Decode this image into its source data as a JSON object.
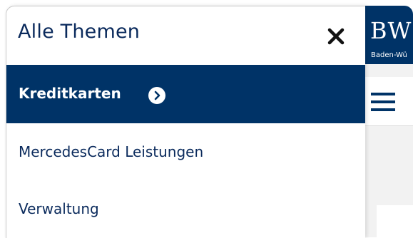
{
  "drawer": {
    "title": "Alle Themen",
    "close_icon": "close-icon",
    "items": [
      {
        "label": "Kreditkarten",
        "active": true,
        "icon": "chevron-right-circle-icon"
      },
      {
        "label": "MercedesCard Leistungen",
        "active": false
      },
      {
        "label": "Verwaltung",
        "active": false
      }
    ]
  },
  "background_page": {
    "logo_text": "BW",
    "logo_subtext": "Baden-Wü",
    "menu_icon": "hamburger-icon"
  },
  "colors": {
    "brand_navy": "#003367",
    "title_text": "#0a2a5c",
    "active_text": "#ffffff",
    "page_background": "#f2f2f2"
  }
}
